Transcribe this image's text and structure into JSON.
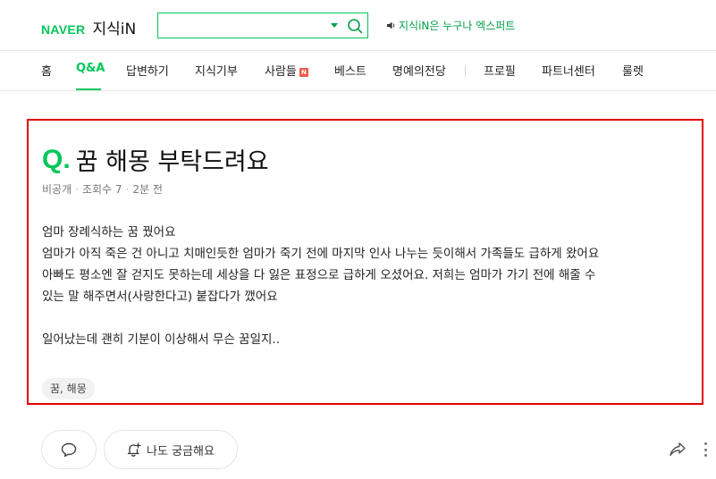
{
  "header": {
    "logo_brand": "NAVER",
    "logo_service": "지식iN",
    "search_placeholder": "",
    "promo_text": "지식iN은 누구나 엑스퍼트"
  },
  "nav": {
    "items": [
      {
        "label": "홈",
        "active": false
      },
      {
        "label": "Q&A",
        "active": true
      },
      {
        "label": "답변하기",
        "active": false
      },
      {
        "label": "지식기부",
        "active": false
      },
      {
        "label": "사람들",
        "active": false,
        "badge": "N"
      },
      {
        "label": "베스트",
        "active": false
      },
      {
        "label": "명예의전당",
        "active": false
      },
      {
        "label": "프로필",
        "active": false
      },
      {
        "label": "파트너센터",
        "active": false
      },
      {
        "label": "룰렛",
        "active": false
      }
    ]
  },
  "question": {
    "mark": "Q",
    "mark_dot": ".",
    "title": "꿈 해몽 부탁드려요",
    "author": "비공개",
    "views": "조회수 7",
    "time": "2분 전",
    "body_lines": [
      "엄마 장례식하는 꿈 꿨어요",
      "엄마가 아직 죽은 건 아니고 치매인듯한 엄마가 죽기 전에 마지막 인사 나누는 듯이해서 가족들도 급하게 왔어요",
      "아빠도 평소엔 잘 걷지도 못하는데 세상을 다 잃은 표정으로 급하게 오셨어요. 저희는 엄마가 가기 전에 해줄 수",
      "있는 말 해주면서(사랑한다고) 붙잡다가 깼어요",
      "",
      "일어났는데 괜히 기분이 이상해서 무슨 꿈일지.."
    ],
    "tag": "꿈, 해몽"
  },
  "actions": {
    "curious_label": "나도 궁금해요"
  },
  "colors": {
    "brand_green": "#03c75a",
    "highlight_red": "#e10000",
    "badge_red": "#f05a4a"
  }
}
